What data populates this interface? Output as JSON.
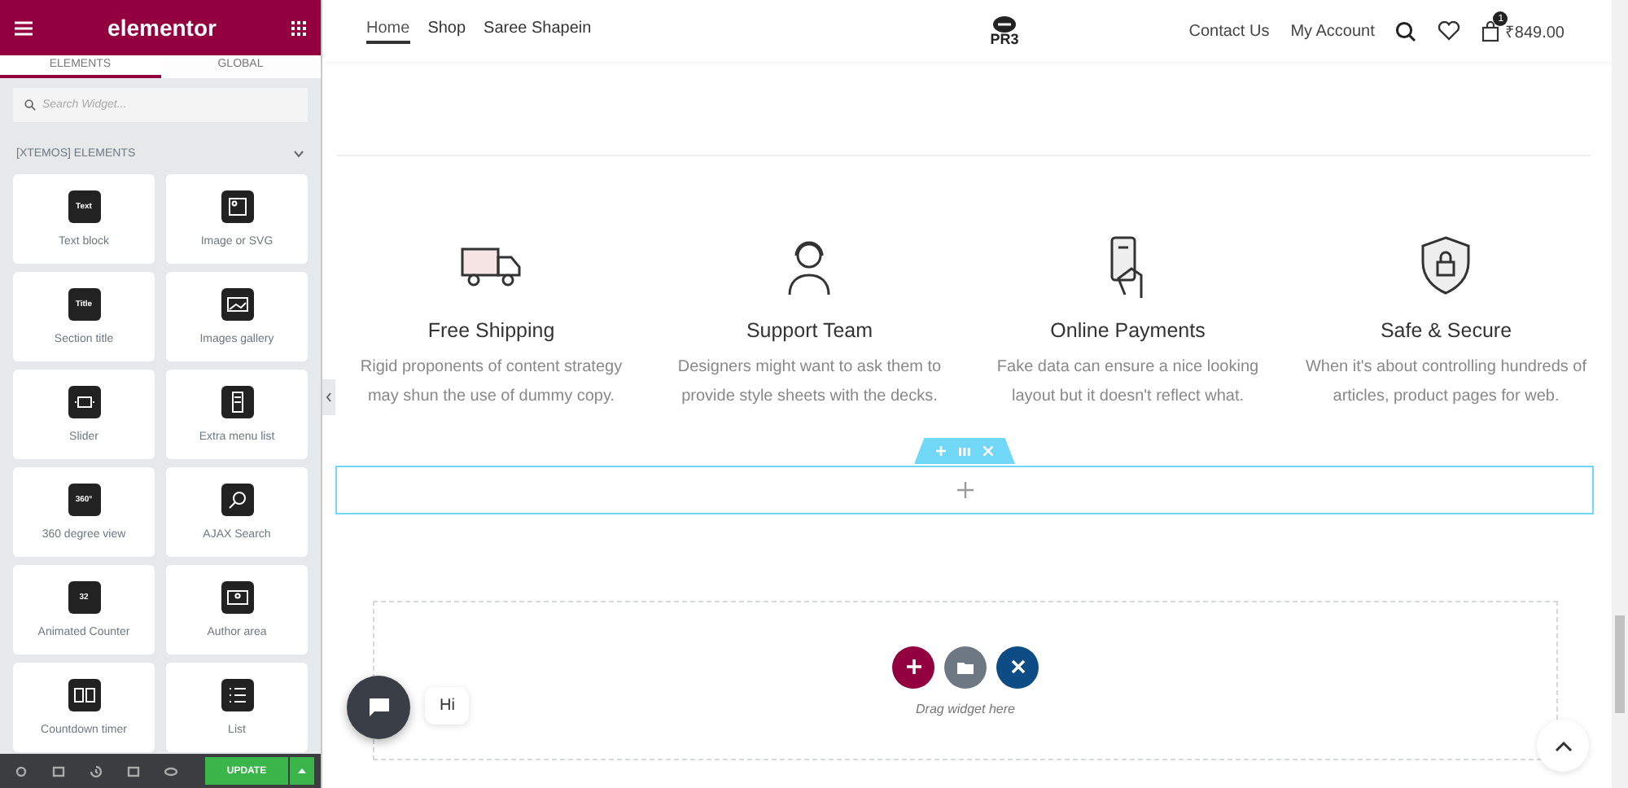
{
  "sidebar": {
    "brand": "elementor",
    "tabs": [
      {
        "label": "ELEMENTS",
        "selected": true
      },
      {
        "label": "GLOBAL",
        "selected": false
      }
    ],
    "search": {
      "placeholder": "Search Widget..."
    },
    "category": {
      "label": "[XTEMOS] ELEMENTS",
      "expanded": true
    },
    "widgets": [
      {
        "label": "Text block",
        "kind": "text",
        "icon_text": "Text"
      },
      {
        "label": "Image or SVG",
        "kind": "image"
      },
      {
        "label": "Section title",
        "kind": "title",
        "icon_text": "Title"
      },
      {
        "label": "Images gallery",
        "kind": "gallery"
      },
      {
        "label": "Slider",
        "kind": "slider"
      },
      {
        "label": "Extra menu list",
        "kind": "menu"
      },
      {
        "label": "360 degree view",
        "kind": "view360",
        "icon_text": "360°"
      },
      {
        "label": "AJAX Search",
        "kind": "search"
      },
      {
        "label": "Animated Counter",
        "kind": "counter",
        "icon_text": "32"
      },
      {
        "label": "Author area",
        "kind": "author"
      },
      {
        "label": "Countdown timer",
        "kind": "timer"
      },
      {
        "label": "List",
        "kind": "list"
      }
    ],
    "footer": {
      "update_button": "UPDATE"
    }
  },
  "header": {
    "nav": [
      {
        "label": "Home",
        "selected": true
      },
      {
        "label": "Shop",
        "selected": false
      },
      {
        "label": "Saree Shapein",
        "selected": false
      }
    ],
    "logo": "PR3",
    "right_nav": [
      "Contact Us",
      "My Account"
    ],
    "cart": {
      "count": "1",
      "total": "₹849.00"
    }
  },
  "features": [
    {
      "kind": "truck",
      "title": "Free Shipping",
      "text": "Rigid proponents of content strategy may shun the use of dummy copy."
    },
    {
      "kind": "support",
      "title": "Support Team",
      "text": "Designers might want to ask them to provide style sheets with the decks."
    },
    {
      "kind": "card",
      "title": "Online Payments",
      "text": "Fake data can ensure a nice looking layout but it doesn't reflect what."
    },
    {
      "kind": "shield",
      "title": "Safe & Secure",
      "text": "When it's about controlling hundreds of articles, product pages for web."
    }
  ],
  "drop_zone": {
    "hint": "Drag widget here"
  },
  "chat": {
    "greeting": "Hi"
  }
}
